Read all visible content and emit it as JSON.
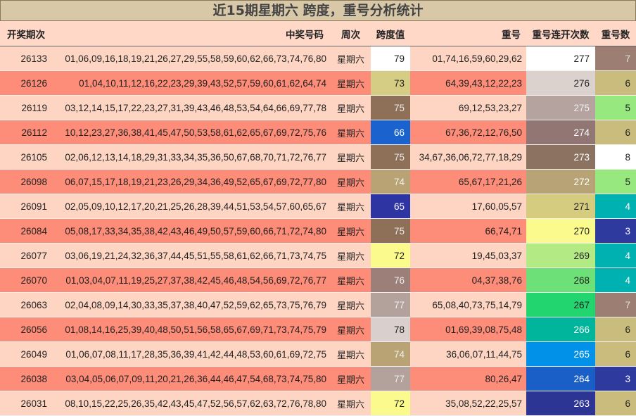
{
  "title": "近15期星期六 跨度，重号分析统计",
  "headers": {
    "issue": "开奖期次",
    "numbers": "中奖号码",
    "weekday": "周次",
    "span": "跨度值",
    "repeat": "重号",
    "streak": "重号连开次数",
    "count": "重号数"
  },
  "colors": {
    "header_bg": "#ffd8c8",
    "row_light": "#fdd5c2",
    "row_dark": "#fd8c78",
    "title_bg": "#d8c8a8"
  },
  "rows": [
    {
      "issue": "26133",
      "numbers": "01,06,09,16,18,19,21,26,27,29,55,58,59,60,62,66,73,74,76,80",
      "weekday": "星期六",
      "span": "79",
      "span_bg": "#ffffff",
      "span_fg": "#222222",
      "repeat": "01,74,16,59,60,29,62",
      "streak": "277",
      "streak_bg": "#ffffff",
      "streak_fg": "#222222",
      "count": "7",
      "count_bg": "#9c7f72",
      "count_fg": "#e0e0e0"
    },
    {
      "issue": "26126",
      "numbers": "01,04,10,11,12,16,22,23,29,39,43,52,57,59,60,61,62,64,74",
      "weekday": "星期六",
      "span": "73",
      "span_bg": "#d5cd84",
      "span_fg": "#222222",
      "repeat": "64,39,43,12,22,23",
      "streak": "276",
      "streak_bg": "#dbd1cd",
      "streak_fg": "#222222",
      "count": "6",
      "count_bg": "#c9bc7c",
      "count_fg": "#222222"
    },
    {
      "issue": "26119",
      "numbers": "03,12,14,15,17,22,23,27,31,39,43,46,48,53,54,64,66,69,77,78",
      "weekday": "星期六",
      "span": "75",
      "span_bg": "#8e7058",
      "span_fg": "#e8e8e8",
      "repeat": "69,12,53,23,27",
      "streak": "275",
      "streak_bg": "#b5a39f",
      "streak_fg": "#eeeeee",
      "count": "5",
      "count_bg": "#97e87e",
      "count_fg": "#222222"
    },
    {
      "issue": "26112",
      "numbers": "10,12,23,27,36,38,41,45,47,50,53,58,61,62,65,67,69,72,75,76",
      "weekday": "星期六",
      "span": "66",
      "span_bg": "#1a63cf",
      "span_fg": "#ffffff",
      "repeat": "67,36,72,12,76,50",
      "streak": "274",
      "streak_bg": "#927673",
      "streak_fg": "#ffffff",
      "count": "6",
      "count_bg": "#c9bc7c",
      "count_fg": "#222222"
    },
    {
      "issue": "26105",
      "numbers": "02,06,12,13,14,18,29,31,33,34,35,36,50,67,68,70,71,72,76,77",
      "weekday": "星期六",
      "span": "75",
      "span_bg": "#8e7058",
      "span_fg": "#e8e8e8",
      "repeat": "34,67,36,06,72,77,18,29",
      "streak": "273",
      "streak_bg": "#8c7361",
      "streak_fg": "#ffffff",
      "count": "8",
      "count_bg": "#ffffff",
      "count_fg": "#222222"
    },
    {
      "issue": "26098",
      "numbers": "06,07,15,17,18,19,21,23,26,29,34,36,49,52,65,67,69,72,77,80",
      "weekday": "星期六",
      "span": "74",
      "span_bg": "#b9a374",
      "span_fg": "#eeeeee",
      "repeat": "65,67,17,21,26",
      "streak": "272",
      "streak_bg": "#b8a377",
      "streak_fg": "#ffffff",
      "count": "5",
      "count_bg": "#97e87e",
      "count_fg": "#222222"
    },
    {
      "issue": "26091",
      "numbers": "02,05,09,10,12,17,20,21,25,26,28,39,44,51,53,54,57,60,65,67",
      "weekday": "星期六",
      "span": "65",
      "span_bg": "#2e34a2",
      "span_fg": "#ffffff",
      "repeat": "17,60,05,57",
      "streak": "271",
      "streak_bg": "#d6cc80",
      "streak_fg": "#222222",
      "count": "4",
      "count_bg": "#00b1b1",
      "count_fg": "#ffffff"
    },
    {
      "issue": "26084",
      "numbers": "05,08,17,33,34,35,38,42,43,46,49,50,57,59,60,66,71,72,74,80",
      "weekday": "星期六",
      "span": "75",
      "span_bg": "#8e7058",
      "span_fg": "#e8e8e8",
      "repeat": "66,74,71",
      "streak": "270",
      "streak_bg": "#fbfa8c",
      "streak_fg": "#222222",
      "count": "3",
      "count_bg": "#2f3a9e",
      "count_fg": "#ffffff"
    },
    {
      "issue": "26077",
      "numbers": "03,06,19,21,24,32,36,37,44,45,51,55,58,61,62,66,71,73,74,75",
      "weekday": "星期六",
      "span": "72",
      "span_bg": "#fbfa8c",
      "span_fg": "#222222",
      "repeat": "19,45,03,37",
      "streak": "269",
      "streak_bg": "#b3ea84",
      "streak_fg": "#222222",
      "count": "4",
      "count_bg": "#00b1b1",
      "count_fg": "#ffffff"
    },
    {
      "issue": "26070",
      "numbers": "01,03,04,07,11,19,25,27,37,38,42,45,46,48,54,56,69,72,76,77",
      "weekday": "星期六",
      "span": "76",
      "span_bg": "#9b7f78",
      "span_fg": "#eeeeee",
      "repeat": "04,37,38,76",
      "streak": "268",
      "streak_bg": "#6de077",
      "streak_fg": "#222222",
      "count": "4",
      "count_bg": "#00b1b1",
      "count_fg": "#ffffff"
    },
    {
      "issue": "26063",
      "numbers": "02,04,08,09,14,30,33,35,37,38,40,47,52,59,62,65,73,75,76,79",
      "weekday": "星期六",
      "span": "77",
      "span_bg": "#b3a19c",
      "span_fg": "#eeeeee",
      "repeat": "65,08,40,73,75,14,79",
      "streak": "267",
      "streak_bg": "#23d56f",
      "streak_fg": "#222222",
      "count": "7",
      "count_bg": "#9c7f72",
      "count_fg": "#e0e0e0"
    },
    {
      "issue": "26056",
      "numbers": "01,08,14,16,25,39,40,48,50,51,56,58,65,67,69,71,73,74,75,79",
      "weekday": "星期六",
      "span": "78",
      "span_bg": "#d9d0cd",
      "span_fg": "#222222",
      "repeat": "01,69,39,08,75,48",
      "streak": "266",
      "streak_bg": "#00b59c",
      "streak_fg": "#ffffff",
      "count": "6",
      "count_bg": "#c9bc7c",
      "count_fg": "#222222"
    },
    {
      "issue": "26049",
      "numbers": "01,06,07,08,11,17,28,35,36,39,41,42,44,48,53,60,61,69,72,75",
      "weekday": "星期六",
      "span": "74",
      "span_bg": "#b9a374",
      "span_fg": "#eeeeee",
      "repeat": "36,06,07,11,44,75",
      "streak": "265",
      "streak_bg": "#0291e8",
      "streak_fg": "#ffffff",
      "count": "6",
      "count_bg": "#c9bc7c",
      "count_fg": "#222222"
    },
    {
      "issue": "26038",
      "numbers": "03,04,05,06,07,09,11,20,21,26,36,44,46,47,54,68,73,74,75,80",
      "weekday": "星期六",
      "span": "77",
      "span_bg": "#b3a19c",
      "span_fg": "#eeeeee",
      "repeat": "80,26,47",
      "streak": "264",
      "streak_bg": "#1a5fc8",
      "streak_fg": "#ffffff",
      "count": "3",
      "count_bg": "#2f3a9e",
      "count_fg": "#ffffff"
    },
    {
      "issue": "26031",
      "numbers": "08,10,15,22,25,26,35,42,43,45,47,52,56,57,62,63,72,76,78,80",
      "weekday": "星期六",
      "span": "72",
      "span_bg": "#fbfa8c",
      "span_fg": "#222222",
      "repeat": "35,08,52,22,25,57",
      "streak": "263",
      "streak_bg": "#2d3594",
      "streak_fg": "#ffffff",
      "count": "6",
      "count_bg": "#c9bc7c",
      "count_fg": "#222222"
    }
  ]
}
